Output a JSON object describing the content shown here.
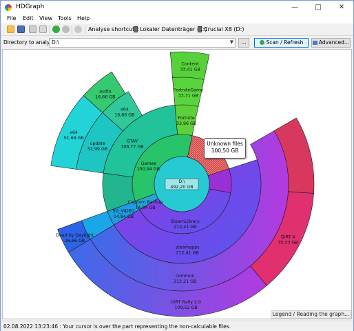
{
  "window": {
    "title": "HDGraph"
  },
  "menu": [
    "File",
    "Edit",
    "View",
    "Tools",
    "Help"
  ],
  "toolbar": {
    "shortcuts_label": "Analyse shortcuts:",
    "drive1": "Lokaler Datenträger (C:)",
    "drive2": "Crucial X8 (D:)"
  },
  "address": {
    "label": "Directory to analyze :",
    "value": "D:\\",
    "browse_label": "...",
    "scan_label": "Scan / Refresh",
    "advanced_label": "Advanced..."
  },
  "graph": {
    "center": {
      "name": "D:\\",
      "size": "492,20 GB"
    },
    "segments": [
      {
        "name": "Unknown files",
        "size": "100,50 GB",
        "color": "#d23b3b"
      },
      {
        "name": "Games",
        "size": "150,94 GB",
        "color": "#27c46a"
      },
      {
        "name": "GTAV",
        "size": "106,77 GB",
        "color": "#20c39a"
      },
      {
        "name": "update",
        "size": "52,99 GB",
        "color": "#1ec5c2"
      },
      {
        "name": "x64",
        "size": "51,69 GB",
        "color": "#22d3d8"
      },
      {
        "name": "x64",
        "size": "16,66 GB",
        "color": "#30c898"
      },
      {
        "name": "audio",
        "size": "16,66 GB",
        "color": "#35c970"
      },
      {
        "name": "Fortnite",
        "size": "33,96 GB",
        "color": "#5ed03a"
      },
      {
        "name": "FortniteGame",
        "size": "33,71 GB",
        "color": "#5ad43c"
      },
      {
        "name": "Content",
        "size": "33,41 GB",
        "color": "#56d13a"
      },
      {
        "name": "Capcom Backup",
        "size": "14,84 GB",
        "color": "#22a8d6"
      },
      {
        "name": "SD_VIDEO",
        "size": "14,84 GB",
        "color": "#1e9de0"
      },
      {
        "name": "SteamLibrary",
        "size": "212,41 GB",
        "color": "#8a3ce6"
      },
      {
        "name": "steamapps",
        "size": "212,41 GB",
        "color": "#7d3ee8"
      },
      {
        "name": "common",
        "size": "212,21 GB",
        "color": "#6a45ea"
      },
      {
        "name": "DiRT Rally 2.0",
        "size": "109,52 GB",
        "color": "#6f48ef"
      },
      {
        "name": "Dead by Daylight",
        "size": "26,66 GB",
        "color": "#2d63e6"
      },
      {
        "name": "DiRT 4",
        "size": "35,33 GB",
        "color": "#e0306f"
      }
    ]
  },
  "tooltip": {
    "title": "Unknown files",
    "size": "100,50 GB"
  },
  "legend_label": "Legend / Reading the graph...",
  "status": "02.08.2022 13:23:46 : Your cursor is over the part representing the non-calculable files."
}
